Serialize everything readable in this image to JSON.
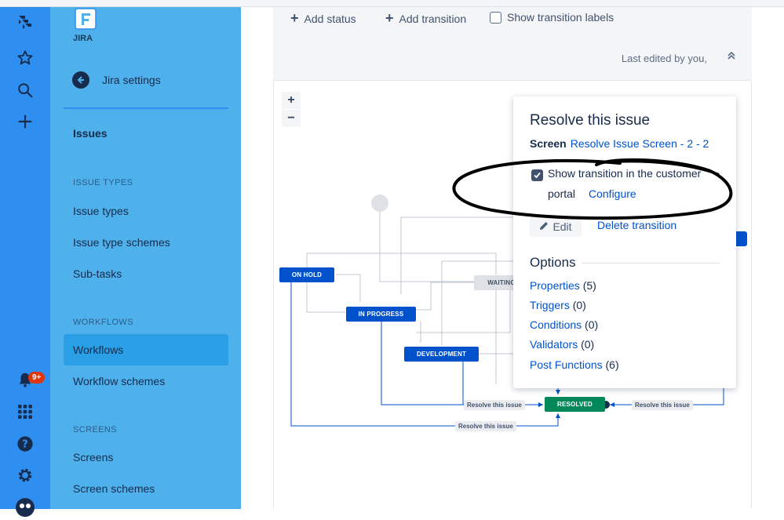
{
  "global_nav": {
    "notification_count": "9+",
    "icons": [
      "jira-logo-icon",
      "star-icon",
      "search-icon",
      "create-plus-icon",
      "notifications-icon",
      "app-switcher-icon",
      "help-icon",
      "settings-icon",
      "profile-avatar-icon"
    ]
  },
  "sidebar": {
    "logo_text": "JIRA",
    "back_label": "Jira settings",
    "top_item": "Issues",
    "sections": [
      {
        "title": "ISSUE TYPES",
        "items": [
          "Issue types",
          "Issue type schemes",
          "Sub-tasks"
        ]
      },
      {
        "title": "WORKFLOWS",
        "items": [
          "Workflows",
          "Workflow schemes"
        ]
      },
      {
        "title": "SCREENS",
        "items": [
          "Screens",
          "Screen schemes"
        ]
      }
    ],
    "active_item": "Workflows"
  },
  "toolbar": {
    "add_status": "Add status",
    "add_transition": "Add transition",
    "show_labels": "Show transition labels",
    "last_edited": "Last edited by you,"
  },
  "diagram": {
    "statuses": [
      {
        "label": "ON HOLD",
        "color": "#0052cc"
      },
      {
        "label": "IN PROGRESS",
        "color": "#0052cc"
      },
      {
        "label": "WAITING",
        "color": "#dfe1e6"
      },
      {
        "label": "DEVELOPMENT",
        "color": "#0052cc"
      },
      {
        "label": "RESOLVED",
        "color": "#00875a"
      }
    ],
    "transition_labels": [
      "Resolve this issue",
      "Resolve this issue",
      "Resolve this issue"
    ]
  },
  "popup": {
    "title": "Resolve this issue",
    "screen_label": "Screen",
    "screen_link": "Resolve Issue Screen - 2 - 2",
    "portal_text_line1": "Show transition in the customer",
    "portal_text_line2": "portal",
    "configure": "Configure",
    "edit": "Edit",
    "delete": "Delete transition",
    "options_heading": "Options",
    "options": [
      {
        "label": "Properties",
        "count": "(5)"
      },
      {
        "label": "Triggers",
        "count": "(0)"
      },
      {
        "label": "Conditions",
        "count": "(0)"
      },
      {
        "label": "Validators",
        "count": "(0)"
      },
      {
        "label": "Post Functions",
        "count": "(6)"
      }
    ]
  },
  "colors": {
    "global_nav": "#2e8ff0",
    "sidebar": "#4eb1ec",
    "link": "#0052cc",
    "status_blue": "#0052cc",
    "status_green": "#00875a"
  }
}
